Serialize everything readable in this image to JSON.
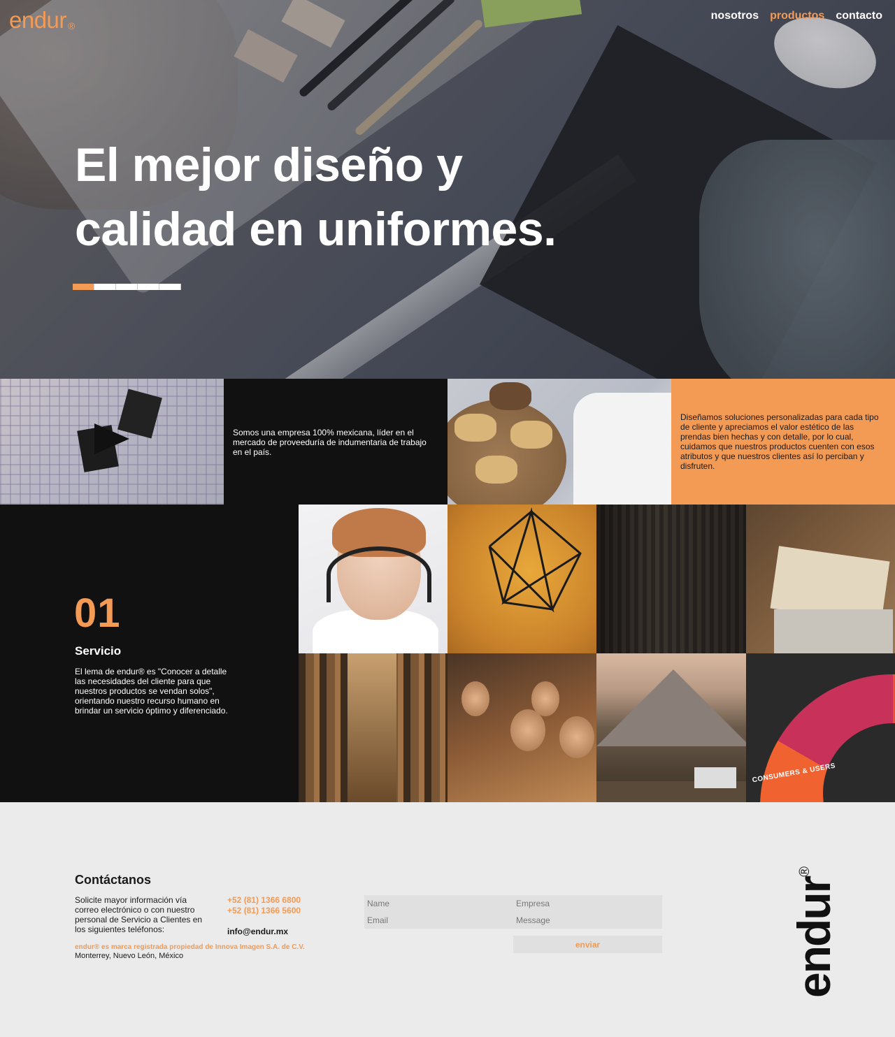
{
  "brand": {
    "logo_text": "endur",
    "registered_mark": "®",
    "accent_color": "#f39a55"
  },
  "nav": {
    "items": [
      "nosotros",
      "productos",
      "contacto"
    ],
    "active": "productos"
  },
  "hero": {
    "title_line1": "El mejor diseño y",
    "title_line2": "calidad en uniformes.",
    "slides_total": 5,
    "slide_active": 1
  },
  "intro": {
    "company_text": "Somos una empresa 100% mexicana, líder en el mercado de proveeduría de indumentaria de trabajo en el país.",
    "solutions_text": "Diseñamos soluciones personalizadas para cada tipo de cliente y apreciamos el valor estético de las prendas bien hechas y con detalle, por lo cual, cuidamos que nuestros productos cuenten con esos atributos y que nuestros clientes así lo perciban y disfruten."
  },
  "service": {
    "number": "01",
    "title": "Servicio",
    "description": "El lema de endur® es \"Conocer a detalle las necesidades del cliente para que nuestros productos se vendan solos\", orientando nuestro recurso humano en brindar un servicio óptimo y diferenciado.",
    "grid_image_label": "CONSUMERS & USERS"
  },
  "footer": {
    "title": "Contáctanos",
    "description": "Solicite mayor información vía correo electrónico o con nuestro personal de Servicio a Clientes en los siguientes teléfonos:",
    "phone1": "+52 (81) 1366 6800",
    "phone2": "+52 (81) 1366 5600",
    "email": "info@endur.mx",
    "trademark": "endur® es marca registrada propiedad de Innova Imagen S.A. de C.V.",
    "location": "Monterrey, Nuevo León, México",
    "form": {
      "name_placeholder": "Name",
      "company_placeholder": "Empresa",
      "email_placeholder": "Email",
      "message_placeholder": "Message",
      "submit_label": "enviar"
    },
    "vertical_logo": "endur",
    "vertical_logo_mark": "®"
  }
}
